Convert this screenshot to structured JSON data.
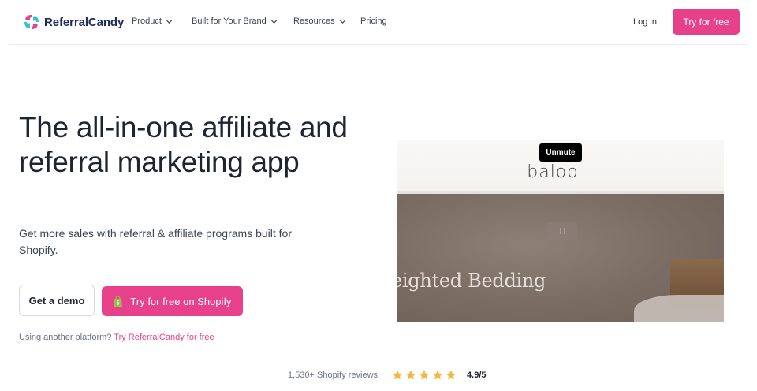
{
  "brand": {
    "name": "ReferralCandy",
    "accent_color": "#e8418b"
  },
  "nav": {
    "items": [
      {
        "label": "Product",
        "has_dropdown": true
      },
      {
        "label": "Built for Your Brand",
        "has_dropdown": true
      },
      {
        "label": "Resources",
        "has_dropdown": true
      },
      {
        "label": "Pricing",
        "has_dropdown": false
      }
    ],
    "login_label": "Log in",
    "cta_label": "Try for free"
  },
  "hero": {
    "headline": "The all-in-one affiliate and referral marketing app",
    "subheadline": "Get more sales with referral & affiliate programs built for Shopify.",
    "demo_button_label": "Get a demo",
    "shopify_button_label": "Try for free on Shopify",
    "other_platform_text": "Using another platform? ",
    "other_platform_link": "Try ReferralCandy for free"
  },
  "video": {
    "unmute_label": "Unmute",
    "brand_word": "baloo",
    "overlay_text": "eighted Bedding",
    "state": "playing"
  },
  "reviews": {
    "count_text": "1,530+ Shopify reviews",
    "stars": 5,
    "rating_text": "4.9/5",
    "star_color": "#f5b840"
  }
}
